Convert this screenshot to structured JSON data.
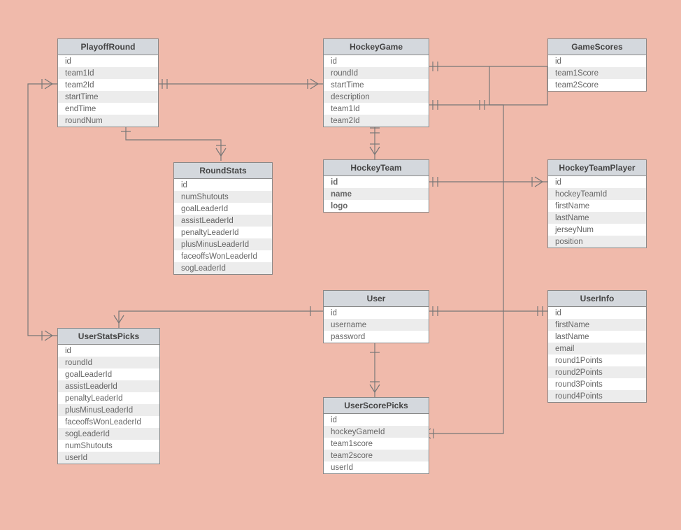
{
  "entities": {
    "PlayoffRound": {
      "title": "PlayoffRound",
      "fields": [
        "id",
        "team1Id",
        "team2Id",
        "startTime",
        "endTime",
        "roundNum"
      ],
      "bold": []
    },
    "HockeyGame": {
      "title": "HockeyGame",
      "fields": [
        "id",
        "roundId",
        "startTime",
        "description",
        "team1Id",
        "team2Id"
      ],
      "bold": []
    },
    "GameScores": {
      "title": "GameScores",
      "fields": [
        "id",
        "team1Score",
        "team2Score"
      ],
      "bold": []
    },
    "RoundStats": {
      "title": "RoundStats",
      "fields": [
        "id",
        "numShutouts",
        "goalLeaderId",
        "assistLeaderId",
        "penaltyLeaderId",
        "plusMinusLeaderId",
        "faceoffsWonLeaderId",
        "sogLeaderId"
      ],
      "bold": []
    },
    "HockeyTeam": {
      "title": "HockeyTeam",
      "fields": [
        "id",
        "name",
        "logo"
      ],
      "bold": [
        "id",
        "name",
        "logo"
      ]
    },
    "HockeyTeamPlayer": {
      "title": "HockeyTeamPlayer",
      "fields": [
        "id",
        "hockeyTeamId",
        "firstName",
        "lastName",
        "jerseyNum",
        "position"
      ],
      "bold": []
    },
    "User": {
      "title": "User",
      "fields": [
        "id",
        "username",
        "password"
      ],
      "bold": []
    },
    "UserInfo": {
      "title": "UserInfo",
      "fields": [
        "id",
        "firstName",
        "lastName",
        "email",
        "round1Points",
        "round2Points",
        "round3Points",
        "round4Points"
      ],
      "bold": []
    },
    "UserStatsPicks": {
      "title": "UserStatsPicks",
      "fields": [
        "id",
        "roundId",
        "goalLeaderId",
        "assistLeaderId",
        "penaltyLeaderId",
        "plusMinusLeaderId",
        "faceoffsWonLeaderId",
        "sogLeaderId",
        "numShutouts",
        "userId"
      ],
      "bold": []
    },
    "UserScorePicks": {
      "title": "UserScorePicks",
      "fields": [
        "id",
        "hockeyGameId",
        "team1score",
        "team2score",
        "userId"
      ],
      "bold": []
    }
  },
  "chart_data": {
    "type": "er-diagram",
    "entities": [
      {
        "name": "PlayoffRound",
        "attributes": [
          "id",
          "team1Id",
          "team2Id",
          "startTime",
          "endTime",
          "roundNum"
        ]
      },
      {
        "name": "HockeyGame",
        "attributes": [
          "id",
          "roundId",
          "startTime",
          "description",
          "team1Id",
          "team2Id"
        ]
      },
      {
        "name": "GameScores",
        "attributes": [
          "id",
          "team1Score",
          "team2Score"
        ]
      },
      {
        "name": "RoundStats",
        "attributes": [
          "id",
          "numShutouts",
          "goalLeaderId",
          "assistLeaderId",
          "penaltyLeaderId",
          "plusMinusLeaderId",
          "faceoffsWonLeaderId",
          "sogLeaderId"
        ]
      },
      {
        "name": "HockeyTeam",
        "attributes": [
          "id",
          "name",
          "logo"
        ]
      },
      {
        "name": "HockeyTeamPlayer",
        "attributes": [
          "id",
          "hockeyTeamId",
          "firstName",
          "lastName",
          "jerseyNum",
          "position"
        ]
      },
      {
        "name": "User",
        "attributes": [
          "id",
          "username",
          "password"
        ]
      },
      {
        "name": "UserInfo",
        "attributes": [
          "id",
          "firstName",
          "lastName",
          "email",
          "round1Points",
          "round2Points",
          "round3Points",
          "round4Points"
        ]
      },
      {
        "name": "UserStatsPicks",
        "attributes": [
          "id",
          "roundId",
          "goalLeaderId",
          "assistLeaderId",
          "penaltyLeaderId",
          "plusMinusLeaderId",
          "faceoffsWonLeaderId",
          "sogLeaderId",
          "numShutouts",
          "userId"
        ]
      },
      {
        "name": "UserScorePicks",
        "attributes": [
          "id",
          "hockeyGameId",
          "team1score",
          "team2score",
          "userId"
        ]
      }
    ],
    "relationships": [
      {
        "from": "PlayoffRound",
        "to": "HockeyGame",
        "type": "one-to-many"
      },
      {
        "from": "HockeyGame",
        "to": "GameScores",
        "type": "one-to-one"
      },
      {
        "from": "PlayoffRound",
        "to": "RoundStats",
        "type": "one-to-many"
      },
      {
        "from": "HockeyGame",
        "to": "HockeyTeam",
        "type": "many-to-one"
      },
      {
        "from": "HockeyTeam",
        "to": "HockeyTeamPlayer",
        "type": "one-to-many"
      },
      {
        "from": "User",
        "to": "UserStatsPicks",
        "type": "one-to-many"
      },
      {
        "from": "User",
        "to": "UserInfo",
        "type": "one-to-one"
      },
      {
        "from": "User",
        "to": "UserScorePicks",
        "type": "one-to-many"
      },
      {
        "from": "UserScorePicks",
        "to": "HockeyGame",
        "type": "many-to-one"
      },
      {
        "from": "UserStatsPicks",
        "to": "PlayoffRound",
        "type": "many-to-one"
      },
      {
        "from": "PlayoffRound",
        "to": "HockeyTeam",
        "type": "many-to-one"
      }
    ]
  }
}
